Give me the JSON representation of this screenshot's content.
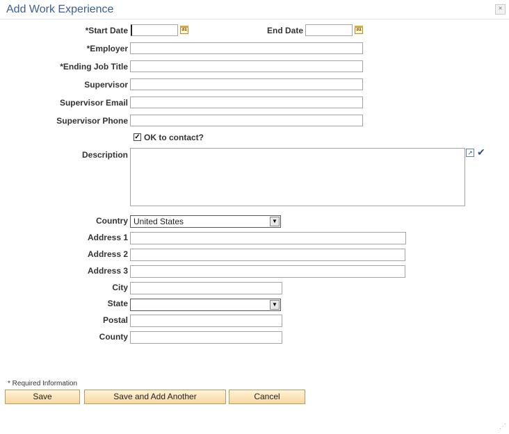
{
  "dialog": {
    "title": "Add Work Experience",
    "close_icon": "×",
    "required_note": "* Required Information"
  },
  "form": {
    "start_date_label": "*Start Date",
    "end_date_label": "End Date",
    "employer_label": "*Employer",
    "ending_job_title_label": "*Ending Job Title",
    "supervisor_label": "Supervisor",
    "supervisor_email_label": "Supervisor Email",
    "supervisor_phone_label": "Supervisor Phone",
    "ok_to_contact_label": "OK to contact?",
    "ok_to_contact_checked": "✓",
    "description_label": "Description",
    "country_label": "Country",
    "country_value": "United States",
    "address1_label": "Address 1",
    "address2_label": "Address 2",
    "address3_label": "Address 3",
    "city_label": "City",
    "state_label": "State",
    "state_value": "",
    "postal_label": "Postal",
    "county_label": "County",
    "calendar_icon": "31",
    "dropdown_arrow": "▼",
    "expand_icon": "↗",
    "spellcheck_icon": "✔"
  },
  "buttons": {
    "save": "Save",
    "save_add_another": "Save and Add Another",
    "cancel": "Cancel"
  },
  "resize_grip": "⋰"
}
